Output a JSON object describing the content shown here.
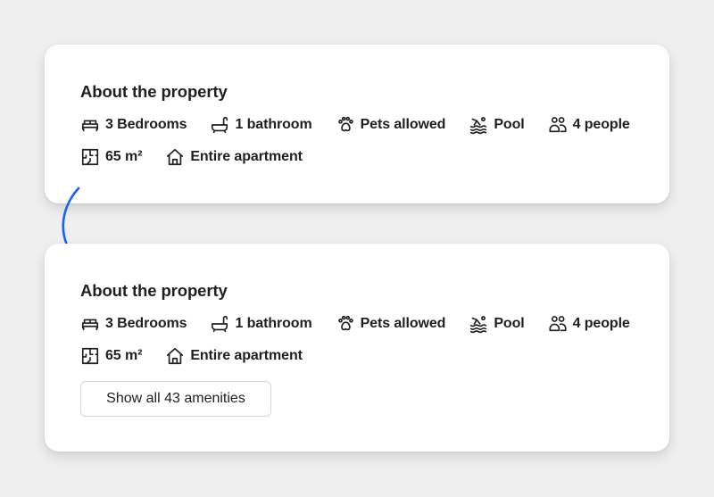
{
  "accent_color": "#1463f3",
  "cards": [
    {
      "title": "About the property",
      "amenities": [
        {
          "icon": "bed-icon",
          "label": "3 Bedrooms"
        },
        {
          "icon": "bathtub-icon",
          "label": "1 bathroom"
        },
        {
          "icon": "paw-icon",
          "label": "Pets allowed"
        },
        {
          "icon": "pool-icon",
          "label": "Pool"
        },
        {
          "icon": "people-icon",
          "label": "4 people"
        },
        {
          "icon": "floorplan-icon",
          "label": "65 m²"
        },
        {
          "icon": "house-icon",
          "label": "Entire apartment"
        }
      ]
    },
    {
      "title": "About the property",
      "amenities": [
        {
          "icon": "bed-icon",
          "label": "3 Bedrooms"
        },
        {
          "icon": "bathtub-icon",
          "label": "1 bathroom"
        },
        {
          "icon": "paw-icon",
          "label": "Pets allowed"
        },
        {
          "icon": "pool-icon",
          "label": "Pool"
        },
        {
          "icon": "people-icon",
          "label": "4 people"
        },
        {
          "icon": "floorplan-icon",
          "label": "65 m²"
        },
        {
          "icon": "house-icon",
          "label": "Entire apartment"
        }
      ],
      "button_label": "Show all 43 amenities"
    }
  ]
}
